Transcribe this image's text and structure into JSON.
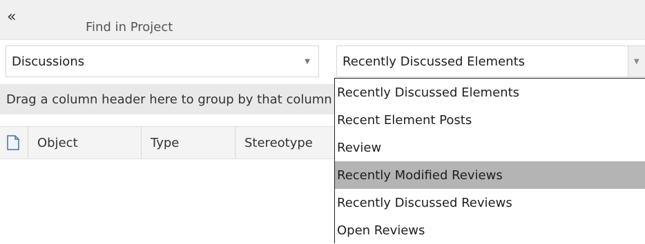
{
  "title_bar": {
    "collapse_glyph": "«",
    "title": "Find in Project"
  },
  "left_combo": {
    "value": "Discussions",
    "arrow": "▼"
  },
  "right_combo": {
    "value": "Recently Discussed Elements",
    "arrow": "▼"
  },
  "group_bar": {
    "text": "Drag a column header here to group by that column"
  },
  "columns": [
    {
      "icon": "document-icon"
    },
    {
      "label": "Object"
    },
    {
      "label": "Type"
    },
    {
      "label": "Stereotype"
    }
  ],
  "dropdown": {
    "items": [
      {
        "label": "Recently Discussed Elements",
        "selected": false
      },
      {
        "label": "Recent Element Posts",
        "selected": false
      },
      {
        "label": "Review",
        "selected": false
      },
      {
        "label": "Recently Modified Reviews",
        "selected": true
      },
      {
        "label": "Recently Discussed Reviews",
        "selected": false
      },
      {
        "label": "Open Reviews",
        "selected": false
      }
    ],
    "highlight_color": "#b4b4b4"
  }
}
